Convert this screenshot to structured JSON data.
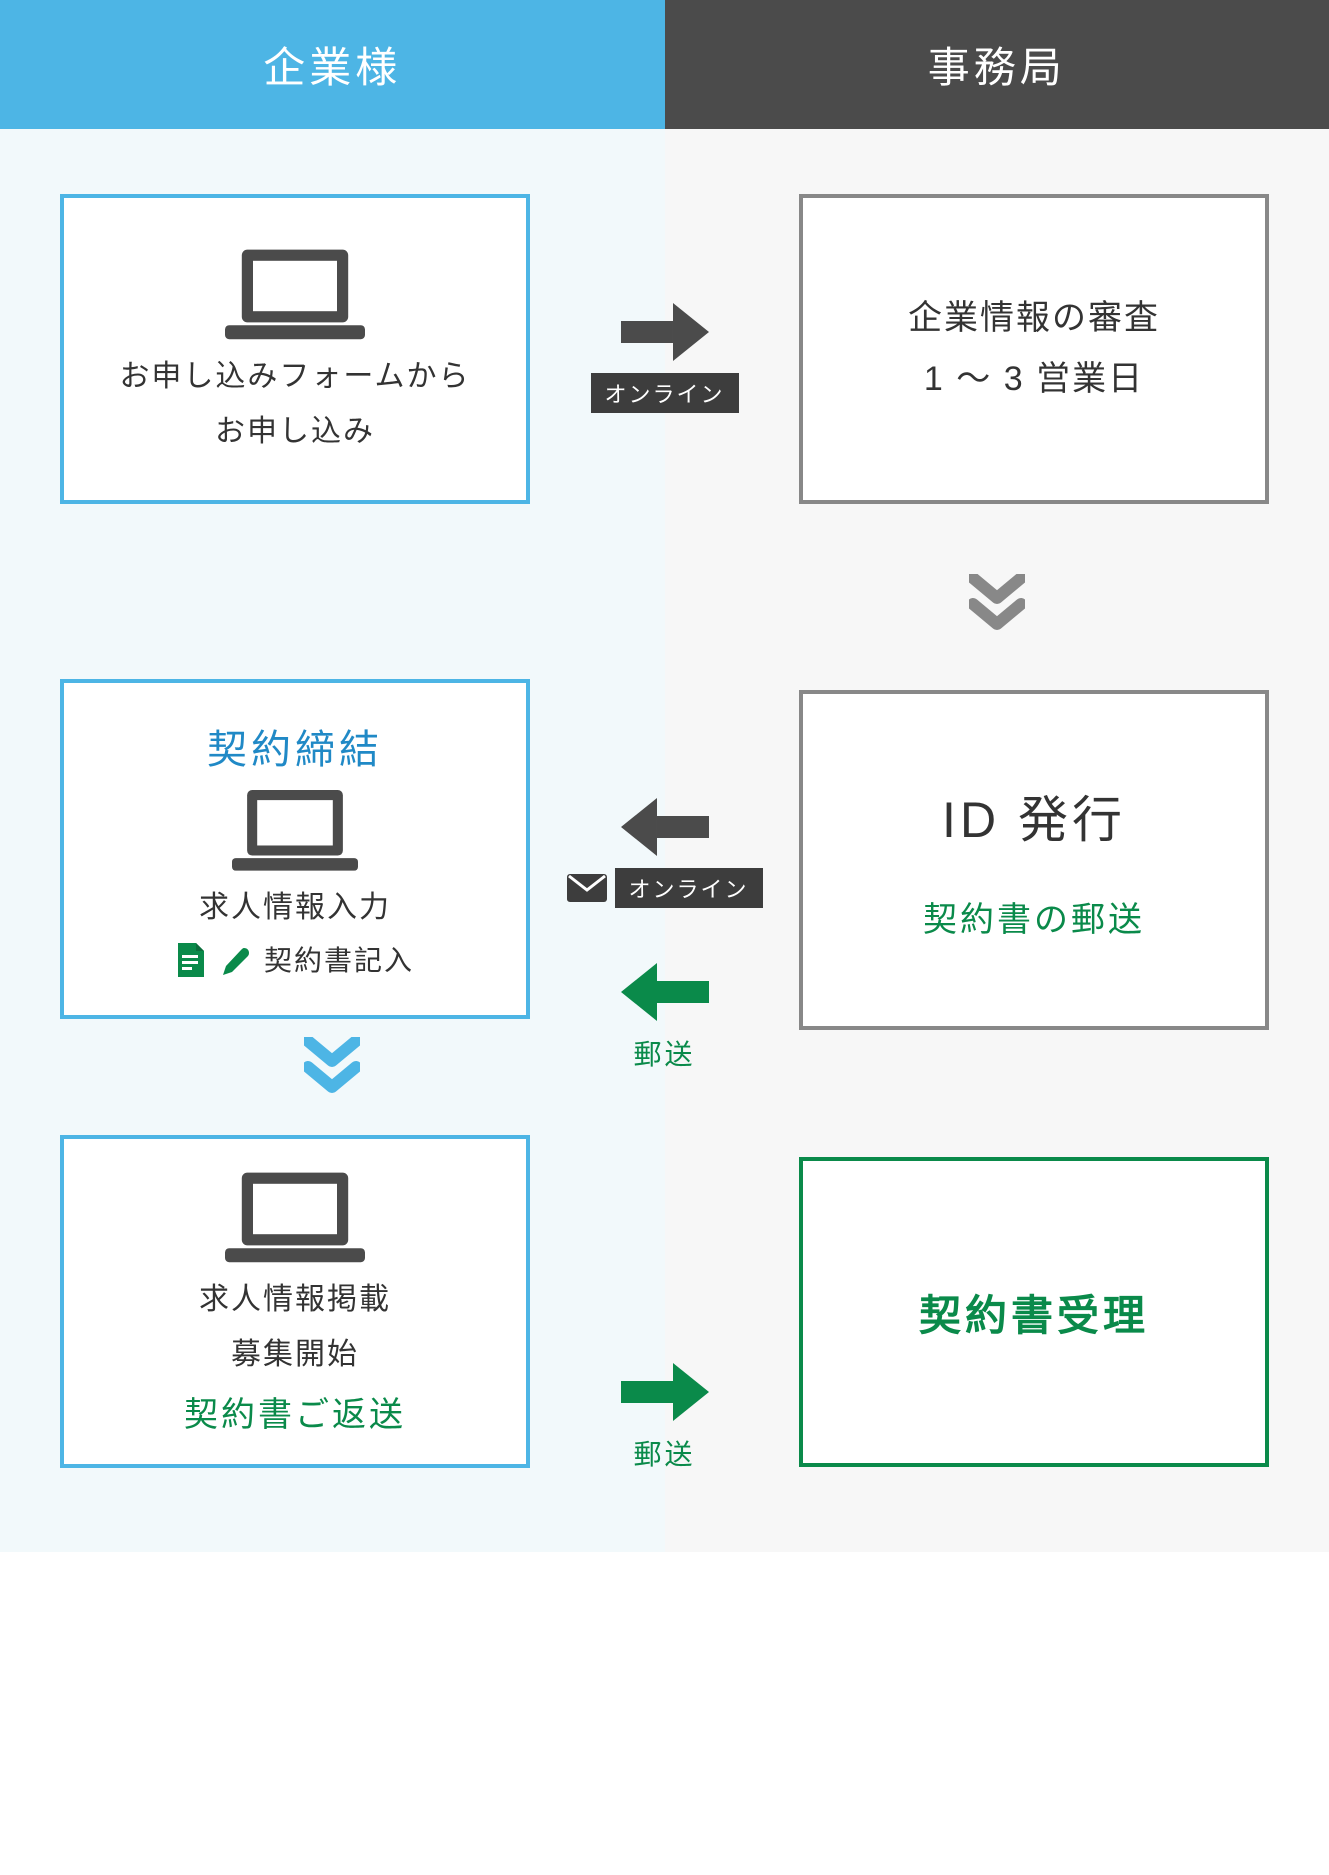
{
  "header": {
    "left": "企業様",
    "right": "事務局"
  },
  "labels": {
    "online": "オンライン",
    "mail": "郵送"
  },
  "left": {
    "step1": {
      "line1": "お申し込みフォームから",
      "line2": "お申し込み"
    },
    "step2": {
      "title": "契約締結",
      "line1": "求人情報入力",
      "line2": "契約書記入"
    },
    "step3": {
      "line1": "求人情報掲載",
      "line2": "募集開始",
      "line3": "契約書ご返送"
    }
  },
  "right": {
    "step1": {
      "line1": "企業情報の審査",
      "line2": "1 〜 3 営業日"
    },
    "step2": {
      "title": "ID 発行",
      "line1": "契約書の郵送"
    },
    "step3": {
      "title": "契約書受理"
    }
  }
}
